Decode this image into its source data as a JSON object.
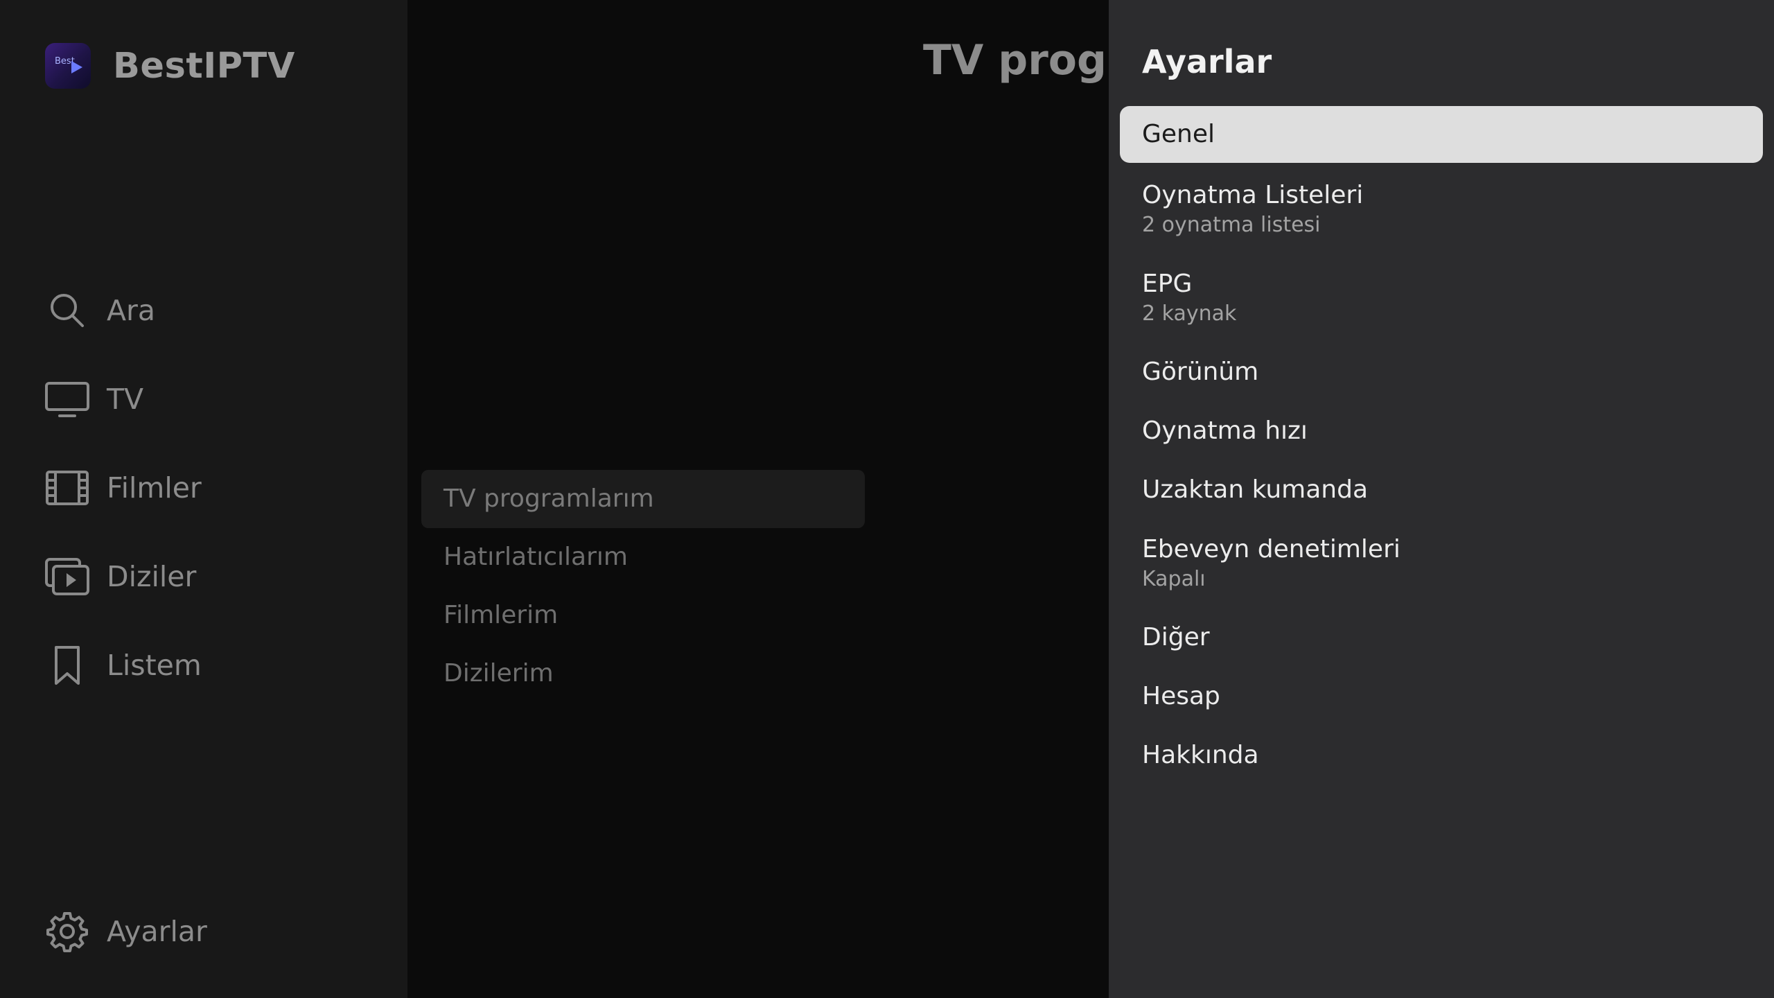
{
  "brand": {
    "name": "BestIPTV",
    "logo_text": "Best"
  },
  "sidebar": {
    "items": [
      {
        "label": "Ara",
        "icon": "search-icon"
      },
      {
        "label": "TV",
        "icon": "tv-icon"
      },
      {
        "label": "Filmler",
        "icon": "film-icon"
      },
      {
        "label": "Diziler",
        "icon": "series-icon"
      },
      {
        "label": "Listem",
        "icon": "bookmark-icon"
      }
    ],
    "settings": {
      "label": "Ayarlar",
      "icon": "gear-icon"
    }
  },
  "main": {
    "title": "TV programlarım",
    "sub_items": [
      {
        "label": "TV programlarım",
        "active": true
      },
      {
        "label": "Hatırlatıcılarım"
      },
      {
        "label": "Filmlerim"
      },
      {
        "label": "Dizilerim"
      }
    ]
  },
  "settings_panel": {
    "title": "Ayarlar",
    "items": [
      {
        "label": "Genel",
        "selected": true
      },
      {
        "label": "Oynatma Listeleri",
        "sub": "2 oynatma listesi"
      },
      {
        "label": "EPG",
        "sub": "2 kaynak"
      },
      {
        "label": "Görünüm"
      },
      {
        "label": "Oynatma hızı"
      },
      {
        "label": "Uzaktan kumanda"
      },
      {
        "label": "Ebeveyn denetimleri",
        "sub": "Kapalı"
      },
      {
        "label": "Diğer"
      },
      {
        "label": "Hesap"
      },
      {
        "label": "Hakkında"
      }
    ]
  },
  "colors": {
    "sidebar_bg": "#181818",
    "main_bg": "#0b0b0b",
    "panel_bg": "#2c2c2e",
    "selected_bg": "#dedede"
  }
}
